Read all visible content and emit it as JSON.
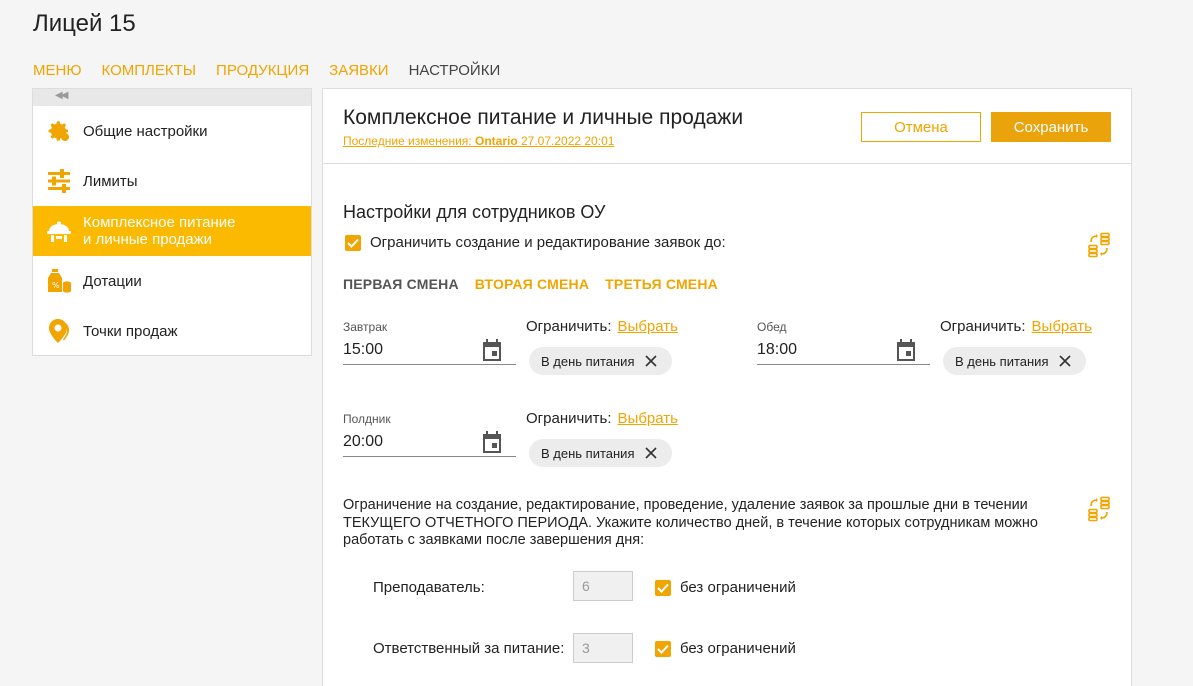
{
  "header": {
    "school_name": "Лицей 15"
  },
  "topnav": [
    "МЕНЮ",
    "КОМПЛЕКТЫ",
    "ПРОДУКЦИЯ",
    "ЗАЯВКИ",
    "НАСТРОЙКИ"
  ],
  "sidebar": {
    "items": [
      {
        "label": "Общие настройки",
        "icon": "gear-icon"
      },
      {
        "label": "Лимиты",
        "icon": "sliders-icon"
      },
      {
        "label_line1": "Комплексное питание",
        "label_line2": "и личные продажи",
        "icon": "food-tray-icon"
      },
      {
        "label": "Дотации",
        "icon": "subsidy-icon"
      },
      {
        "label": "Точки продаж",
        "icon": "location-pin-icon"
      }
    ]
  },
  "main": {
    "title": "Комплексное питание и личные продажи",
    "last_change_prefix": "Последние изменения: ",
    "last_change_user": "Ontario",
    "last_change_date": " 27.07.2022 20:01",
    "cancel_label": "Отмена",
    "save_label": "Сохранить",
    "section_title": "Настройки для сотрудников ОУ",
    "restrict_checkbox_label": "Ограничить создание и редактирование заявок до:",
    "shifts": [
      "ПЕРВАЯ СМЕНА",
      "ВТОРАЯ СМЕНА",
      "ТРЕТЬЯ СМЕНА"
    ],
    "limit_text": "Ограничить:",
    "pick_text": "Выбрать",
    "meals": [
      {
        "label": "Завтрак",
        "time": "15:00",
        "chip": "В день питания"
      },
      {
        "label": "Обед",
        "time": "18:00",
        "chip": "В день питания"
      },
      {
        "label": "Полдник",
        "time": "20:00",
        "chip": "В день питания"
      }
    ],
    "past_days_text": "Ограничение на создание, редактирование, проведение, удаление заявок за прошлые дни в течении ТЕКУЩЕГО ОТЧЕТНОГО ПЕРИОДА. Укажите количество дней, в течение которых сотрудникам можно работать с заявками после завершения дня:",
    "roles": [
      {
        "label": "Преподаватель:",
        "days": "6",
        "unlimited_label": "без ограничений"
      },
      {
        "label": "Ответственный за питание:",
        "days": "3",
        "unlimited_label": "без ограничений"
      }
    ]
  },
  "colors": {
    "accent": "#f0a500",
    "active_bg": "#fbb900",
    "save_bg": "#eaa30b"
  }
}
